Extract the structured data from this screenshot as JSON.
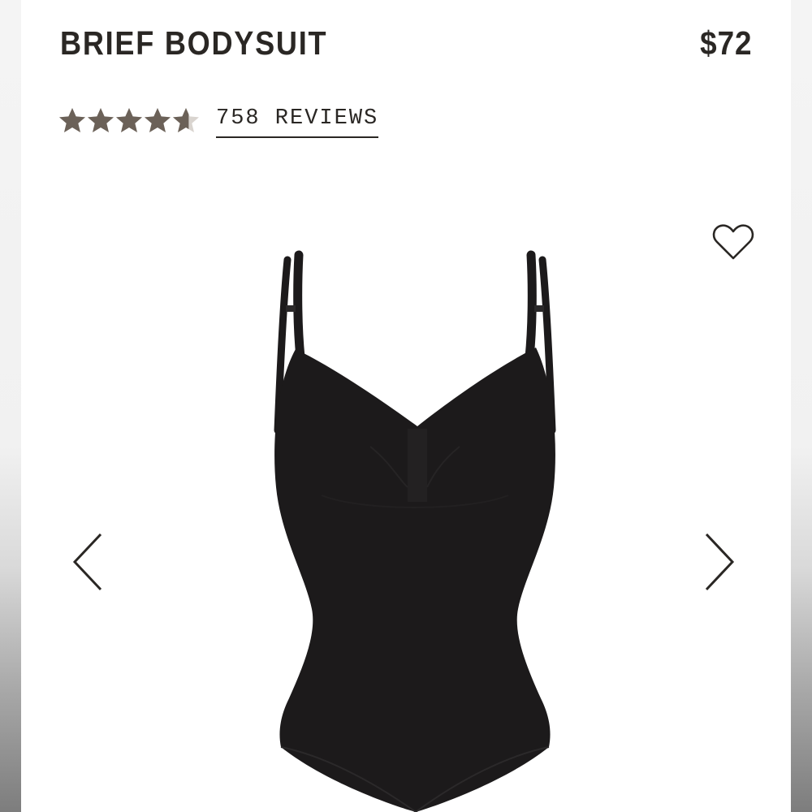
{
  "product": {
    "title": "BRIEF BODYSUIT",
    "price": "$72"
  },
  "rating": {
    "value": 4.6,
    "max": 5,
    "star_color": "#6b6158",
    "star_empty_color": "#d9d4cf",
    "reviews_label": "758 REVIEWS"
  },
  "icons": {
    "wishlist": "heart-outline-icon",
    "prev": "chevron-left-icon",
    "next": "chevron-right-icon"
  },
  "colors": {
    "text": "#2a2724",
    "garment": "#1c1a1b"
  },
  "gallery": {
    "image_subject": "black bodysuit"
  }
}
